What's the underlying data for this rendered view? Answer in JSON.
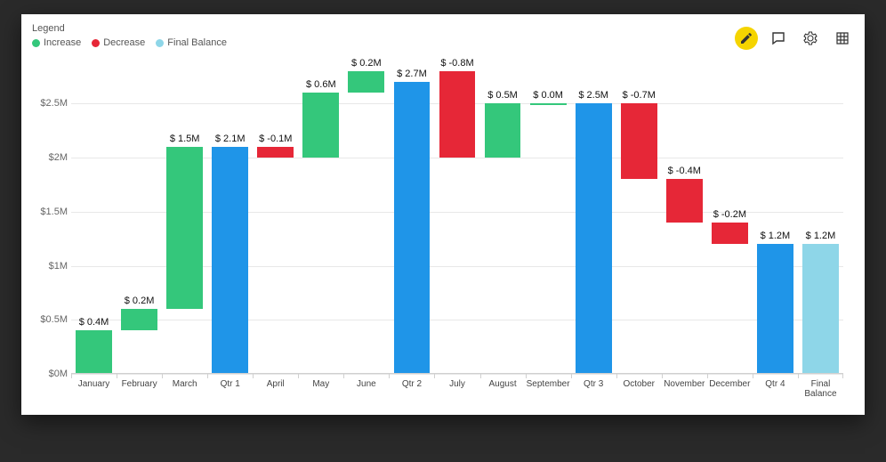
{
  "legend": {
    "title": "Legend",
    "items": [
      {
        "label": "Increase",
        "color": "#34c77b"
      },
      {
        "label": "Decrease",
        "color": "#e62737"
      },
      {
        "label": "Final Balance",
        "color": "#8ed6e8"
      }
    ]
  },
  "toolbar": {
    "edit": "Edit",
    "comment": "Comment",
    "settings": "Settings",
    "grid": "Grid"
  },
  "chart_data": {
    "type": "waterfall",
    "title": "",
    "xlabel": "",
    "ylabel": "",
    "ylim": [
      0,
      2.8
    ],
    "y_ticks": [
      0,
      0.5,
      1.0,
      1.5,
      2.0,
      2.5
    ],
    "y_tick_labels": [
      "$0M",
      "$0.5M",
      "$1M",
      "$1.5M",
      "$2M",
      "$2.5M"
    ],
    "colors": {
      "increase": "#34c77b",
      "decrease": "#e62737",
      "subtotal": "#1f95e8",
      "final": "#8ed6e8"
    },
    "series": [
      {
        "category": "January",
        "kind": "increase",
        "delta": 0.4,
        "start": 0.0,
        "end": 0.4,
        "label": "$ 0.4M"
      },
      {
        "category": "February",
        "kind": "increase",
        "delta": 0.2,
        "start": 0.4,
        "end": 0.6,
        "label": "$ 0.2M"
      },
      {
        "category": "March",
        "kind": "increase",
        "delta": 1.5,
        "start": 0.6,
        "end": 2.1,
        "label": "$ 1.5M"
      },
      {
        "category": "Qtr 1",
        "kind": "subtotal",
        "delta": 2.1,
        "start": 0.0,
        "end": 2.1,
        "label": "$ 2.1M"
      },
      {
        "category": "April",
        "kind": "decrease",
        "delta": -0.1,
        "start": 2.1,
        "end": 2.0,
        "label": "$ -0.1M"
      },
      {
        "category": "May",
        "kind": "increase",
        "delta": 0.6,
        "start": 2.0,
        "end": 2.6,
        "label": "$ 0.6M"
      },
      {
        "category": "June",
        "kind": "increase",
        "delta": 0.2,
        "start": 2.6,
        "end": 2.8,
        "label": "$ 0.2M"
      },
      {
        "category": "Qtr 2",
        "kind": "subtotal",
        "delta": 2.7,
        "start": 0.0,
        "end": 2.7,
        "label": "$ 2.7M"
      },
      {
        "category": "July",
        "kind": "decrease",
        "delta": -0.8,
        "start": 2.8,
        "end": 2.0,
        "label": "$ -0.8M"
      },
      {
        "category": "August",
        "kind": "increase",
        "delta": 0.5,
        "start": 2.0,
        "end": 2.5,
        "label": "$ 0.5M"
      },
      {
        "category": "September",
        "kind": "increase",
        "delta": 0.0,
        "start": 2.5,
        "end": 2.5,
        "label": "$ 0.0M"
      },
      {
        "category": "Qtr 3",
        "kind": "subtotal",
        "delta": 2.5,
        "start": 0.0,
        "end": 2.5,
        "label": "$ 2.5M"
      },
      {
        "category": "October",
        "kind": "decrease",
        "delta": -0.7,
        "start": 2.5,
        "end": 1.8,
        "label": "$ -0.7M"
      },
      {
        "category": "November",
        "kind": "decrease",
        "delta": -0.4,
        "start": 1.8,
        "end": 1.4,
        "label": "$ -0.4M"
      },
      {
        "category": "December",
        "kind": "decrease",
        "delta": -0.2,
        "start": 1.4,
        "end": 1.2,
        "label": "$ -0.2M"
      },
      {
        "category": "Qtr 4",
        "kind": "subtotal",
        "delta": 1.2,
        "start": 0.0,
        "end": 1.2,
        "label": "$ 1.2M"
      },
      {
        "category": "Final Balance",
        "kind": "final",
        "delta": 1.2,
        "start": 0.0,
        "end": 1.2,
        "label": "$ 1.2M"
      }
    ],
    "x_labels": [
      "January",
      "February",
      "March",
      "Qtr 1",
      "April",
      "May",
      "June",
      "Qtr 2",
      "July",
      "August",
      "September",
      "Qtr 3",
      "October",
      "November",
      "December",
      "Qtr 4",
      "Final\nBalance"
    ]
  }
}
